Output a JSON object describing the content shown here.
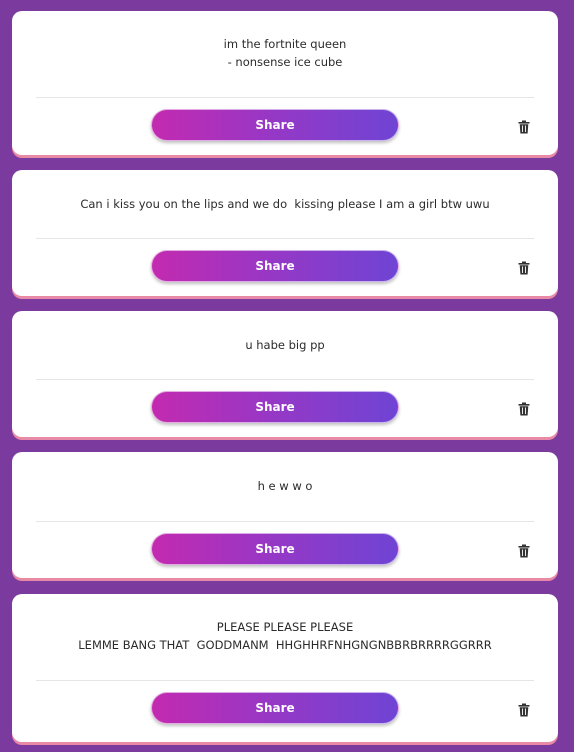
{
  "colors": {
    "background": "#7a3a9e",
    "card": "#ffffff",
    "card_shadow": "#e88aa6",
    "share_gradient_start": "#c32ab0",
    "share_gradient_end": "#6f44d4"
  },
  "messages": [
    {
      "text": "im the fortnite queen\n- nonsense ice cube",
      "share_label": "Share",
      "delete_icon": "trash-icon"
    },
    {
      "text": "Can i kiss you on the lips and we do  kissing please I am a girl btw uwu",
      "share_label": "Share",
      "delete_icon": "trash-icon"
    },
    {
      "text": "u habe big pp",
      "share_label": "Share",
      "delete_icon": "trash-icon"
    },
    {
      "text": "h e w w o",
      "share_label": "Share",
      "delete_icon": "trash-icon"
    },
    {
      "text": "PLEASE PLEASE PLEASE\nLEMME BANG THAT  GODDMANM  HHGHHRFNHGNGNBBRBRRRRGGRRR",
      "share_label": "Share",
      "delete_icon": "trash-icon"
    }
  ]
}
